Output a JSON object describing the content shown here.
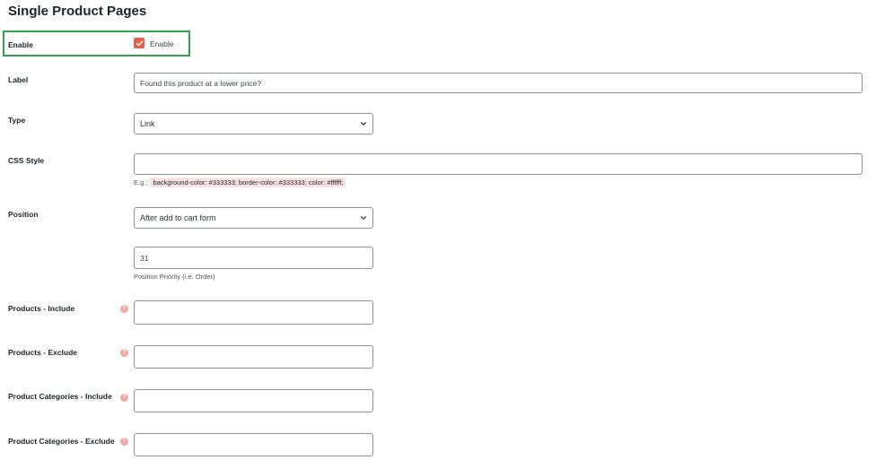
{
  "section": {
    "title": "Single Product Pages"
  },
  "enable": {
    "label": "Enable",
    "checkbox_label": "Enable",
    "checked": true
  },
  "label_field": {
    "label": "Label",
    "value": "Found this product at a lower price?"
  },
  "type_field": {
    "label": "Type",
    "selected": "Link"
  },
  "css_style": {
    "label": "CSS Style",
    "value": "",
    "example_prefix": "E.g.:",
    "example_code": "background-color: #333333; border-color: #333333; color: #ffffff;"
  },
  "position": {
    "label": "Position",
    "selected": "After add to cart form",
    "priority_value": "31",
    "priority_help": "Position Priority (i.e. Order)"
  },
  "products_include": {
    "label": "Products - Include",
    "help_icon": "?"
  },
  "products_exclude": {
    "label": "Products - Exclude",
    "help_icon": "?"
  },
  "categories_include": {
    "label": "Product Categories - Include",
    "help_icon": "?"
  },
  "categories_exclude": {
    "label": "Product Categories - Exclude",
    "help_icon": "?"
  },
  "colors": {
    "accent": "#e8604c",
    "highlight": "#2ea44f",
    "code_bg": "#fbe3e4",
    "help_tip": "#f0a7a0"
  }
}
